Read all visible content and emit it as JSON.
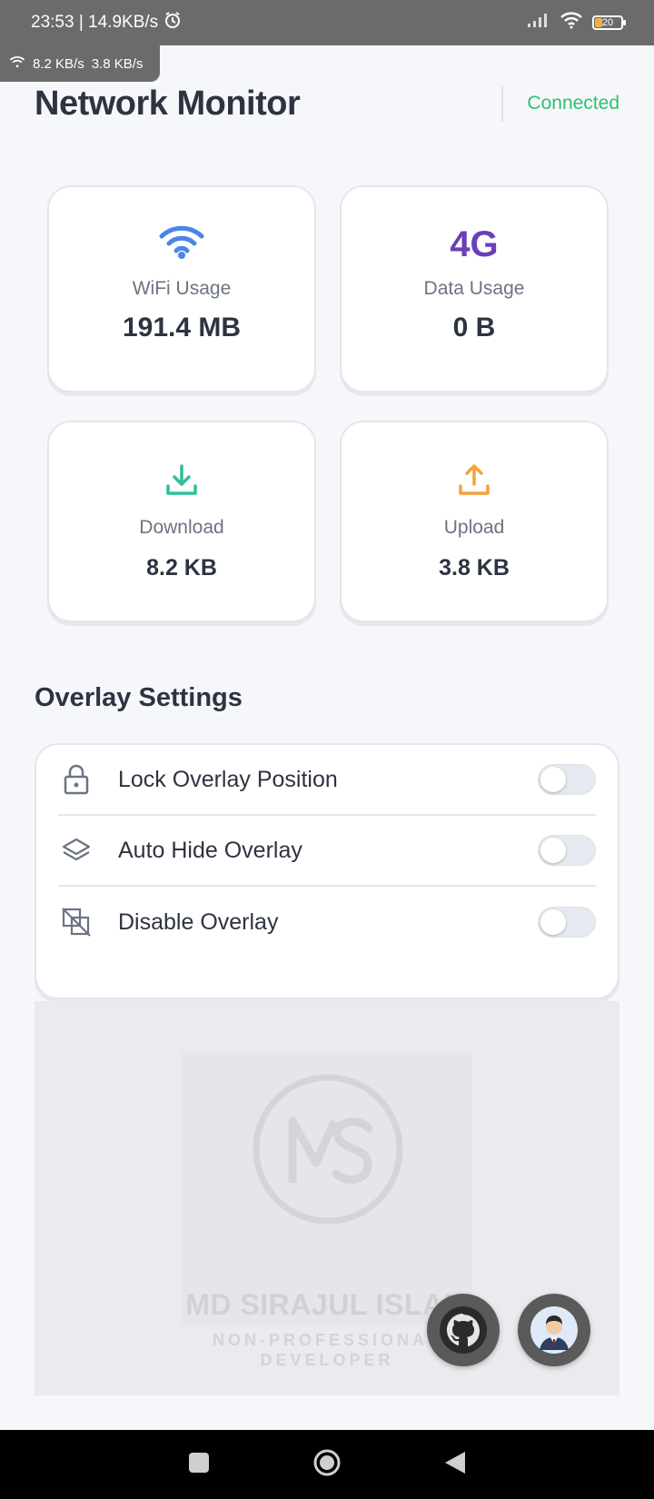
{
  "status_bar": {
    "time_speed": "23:53 | 14.9KB/s",
    "battery": "20",
    "icons": [
      "alarm-icon",
      "signal-icon",
      "wifi-icon",
      "battery-icon"
    ]
  },
  "speed_overlay": {
    "download": "8.2 KB/s",
    "upload": "3.8 KB/s"
  },
  "header": {
    "title": "Network Monitor",
    "status": "Connected",
    "status_color": "#2fbf71"
  },
  "cards": {
    "wifi": {
      "label": "WiFi Usage",
      "value": "191.4 MB",
      "icon": "wifi-icon",
      "color": "#4a86e8"
    },
    "data": {
      "label": "Data Usage",
      "value": "0 B",
      "icon_text": "4G",
      "color": "#6a3fb8"
    },
    "download": {
      "label": "Download",
      "value": "8.2 KB",
      "icon": "download-icon",
      "color": "#2fbf9a"
    },
    "upload": {
      "label": "Upload",
      "value": "3.8 KB",
      "icon": "upload-icon",
      "color": "#f2a33a"
    }
  },
  "overlay_settings": {
    "title": "Overlay Settings",
    "items": [
      {
        "label": "Lock Overlay Position",
        "icon": "lock-icon",
        "enabled": false
      },
      {
        "label": "Auto Hide Overlay",
        "icon": "layers-icon",
        "enabled": false
      },
      {
        "label": "Disable Overlay",
        "icon": "overlay-off-icon",
        "enabled": false
      }
    ]
  },
  "developer_banner": {
    "monogram": "MS",
    "name": "MD SIRAJUL ISLAM",
    "subtitle_line1": "NON-PROFESSIONAL",
    "subtitle_line2": "DEVELOPER",
    "buttons": [
      "github-icon",
      "profile-avatar-icon"
    ]
  },
  "nav_bar": {
    "icons": [
      "recents-icon",
      "home-icon",
      "back-icon"
    ]
  }
}
